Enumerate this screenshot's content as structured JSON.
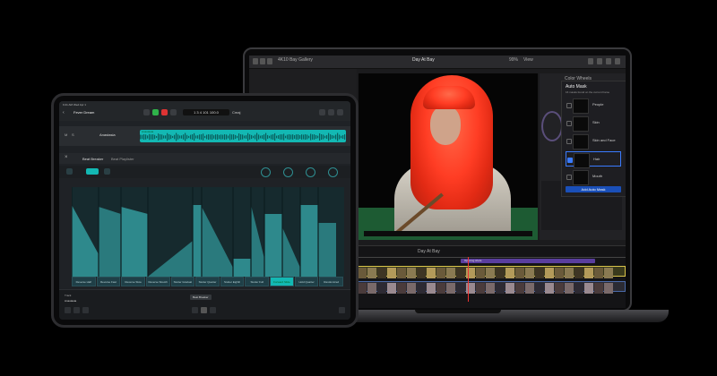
{
  "laptop": {
    "window_title": "Day At Bay",
    "toolbar_left": "4K10 Bay Gallery",
    "zoom": "99%",
    "view_label": "View",
    "inspector_title": "Color Wheels",
    "automask": {
      "title": "Auto Mask",
      "subtitle": "16 masks found on the current frame",
      "items": [
        "People",
        "Skin",
        "Skin and Face",
        "Hair",
        "Mouth"
      ],
      "selected": "Hair",
      "add_button": "Add Auto Mask"
    },
    "timeline": {
      "project": "Day At Bay",
      "clip_label": "Opening shots"
    }
  },
  "ipad": {
    "status_time": "9:41 AM",
    "status_date": "Wed Apr 1",
    "project_title": "Fever Dream",
    "lcd": "1 3 4 101 100.0",
    "lcd_key": "Cmaj",
    "track_name": "Anastasia",
    "plugin_name": "Beat Breaker",
    "plugin_preset": "Beat Playlister",
    "pads": [
      "Reverse Half",
      "Reverse Fast",
      "Reverse Slow",
      "Reverse Stretch",
      "Stutter Gradual",
      "Stutter Quarter",
      "Stutter Eighth",
      "Stutter Full",
      "Forward Slide",
      "Hold Quarter",
      "Randomized Shuffle"
    ],
    "active_pad": "Forward Slide",
    "bottom_track_label": "Track",
    "bottom_track_value": "Anastasia",
    "beat_breaker_chip": "Beat Breaker"
  },
  "colors": {
    "teal_region": "#13b8b3",
    "graph_fill": "#2f8e91",
    "hair": "#ff3d24",
    "mask_button": "#1a4fb8"
  }
}
